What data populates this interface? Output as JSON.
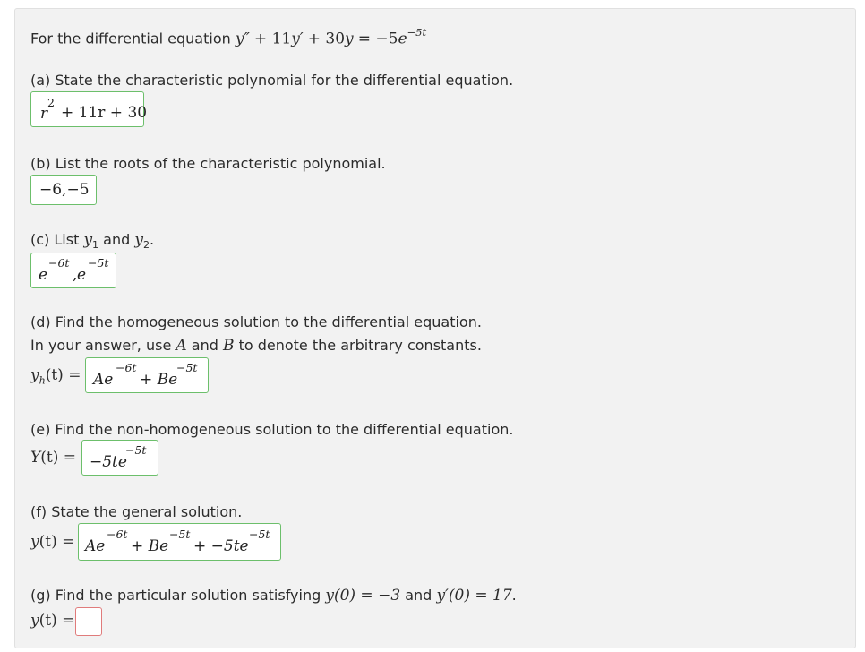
{
  "question": {
    "intro_text": "For the differential equation",
    "equation": {
      "y2": "y″",
      "plus1": "+ 11",
      "y1": "y′",
      "plus2": "+ 30",
      "y0": "y",
      "equals": "= −5",
      "e": "e",
      "exp": "−5t"
    }
  },
  "parts": {
    "a": {
      "prompt": "(a) State the characteristic polynomial for the differential equation.",
      "answer": {
        "base": "r",
        "exp": "2",
        "rest": "+ 11r + 30"
      }
    },
    "b": {
      "prompt": "(b) List the roots of the characteristic polynomial.",
      "answer": "−6,−5"
    },
    "c": {
      "prompt_pre": "(c) List",
      "y1": "y",
      "sub1": "1",
      "mid": "and",
      "y2": "y",
      "sub2": "2",
      "period": ".",
      "answer": {
        "e1": "e",
        "exp1": "−6t",
        "comma": ",",
        "e2": "e",
        "exp2": "−5t"
      }
    },
    "d": {
      "prompt": "(d) Find the homogeneous solution to the differential equation.",
      "prompt2_pre": "In your answer, use",
      "A": "A",
      "and": "and",
      "B": "B",
      "prompt2_post": "to denote the arbitrary constants.",
      "label": {
        "y": "y",
        "sub": "h",
        "arg": "(t)",
        "eq": "="
      },
      "answer": {
        "t1": "Ae",
        "exp1": "−6t",
        "plus": "+ Be",
        "exp2": "−5t"
      }
    },
    "e": {
      "prompt": "(e) Find the non-homogeneous solution to the differential equation.",
      "label": {
        "Y": "Y",
        "arg": "(t)",
        "eq": "="
      },
      "answer": {
        "t1": "−5te",
        "exp1": "−5t"
      }
    },
    "f": {
      "prompt": "(f) State the general solution.",
      "label": {
        "y": "y",
        "arg": "(t)",
        "eq": "="
      },
      "answer": {
        "t1": "Ae",
        "exp1": "−6t",
        "t2": "+ Be",
        "exp2": "−5t",
        "t3": "+ −5te",
        "exp3": "−5t"
      }
    },
    "g": {
      "prompt_pre": "(g) Find the particular solution satisfying",
      "cond1": "y(0) = −3",
      "and": "and",
      "cond2": "y′(0) = 17",
      "period": ".",
      "label": {
        "y": "y",
        "arg": "(t)",
        "eq": "="
      },
      "answer": ""
    }
  },
  "colors": {
    "correct_border": "#6cbf6b",
    "empty_border": "#e07b7b",
    "panel_bg": "#f2f2f2"
  }
}
